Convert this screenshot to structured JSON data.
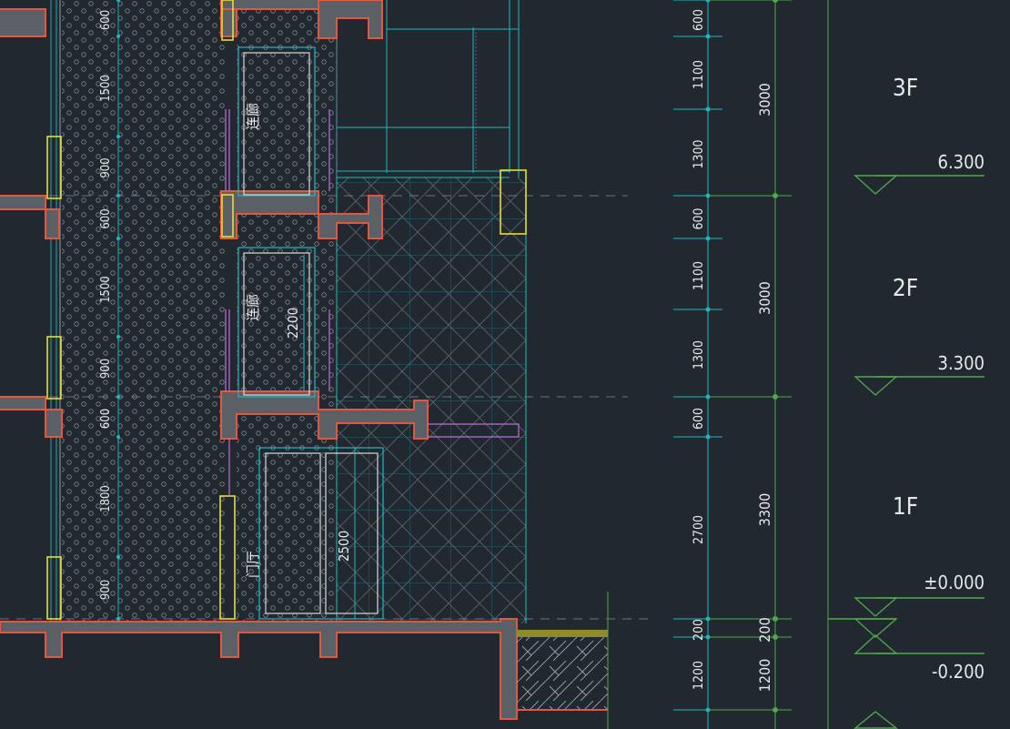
{
  "colors": {
    "background": "#212830",
    "wall_outline": "#e2573d",
    "wall_fill": "#5b5f66",
    "cyan_line": "#1fb7c0",
    "green_line": "#4fa84a",
    "yellow_frame": "#e6e02a",
    "magenta_line": "#c46ad9",
    "text": "#e8e8e8",
    "gray_dash": "#8a8f96"
  },
  "floors": [
    {
      "label": "3F"
    },
    {
      "label": "2F"
    },
    {
      "label": "1F"
    }
  ],
  "elevations": [
    {
      "value": "6.300"
    },
    {
      "value": "3.300"
    },
    {
      "value": "±0.000"
    },
    {
      "value": "-0.200"
    }
  ],
  "dim_col1": [
    "600",
    "1100",
    "1300",
    "600",
    "1100",
    "1300",
    "600",
    "2700",
    "200",
    "1200"
  ],
  "dim_col2": [
    "3000",
    "3000",
    "3300",
    "200",
    "1200"
  ],
  "dim_left": [
    "600",
    "1500",
    "900",
    "600",
    "1500",
    "900",
    "600",
    "1800",
    "900"
  ],
  "rooms": [
    {
      "label": "连廊"
    },
    {
      "label": "连廊"
    },
    {
      "label": "门厅"
    }
  ],
  "inner_dims": [
    "2200",
    "2500"
  ]
}
